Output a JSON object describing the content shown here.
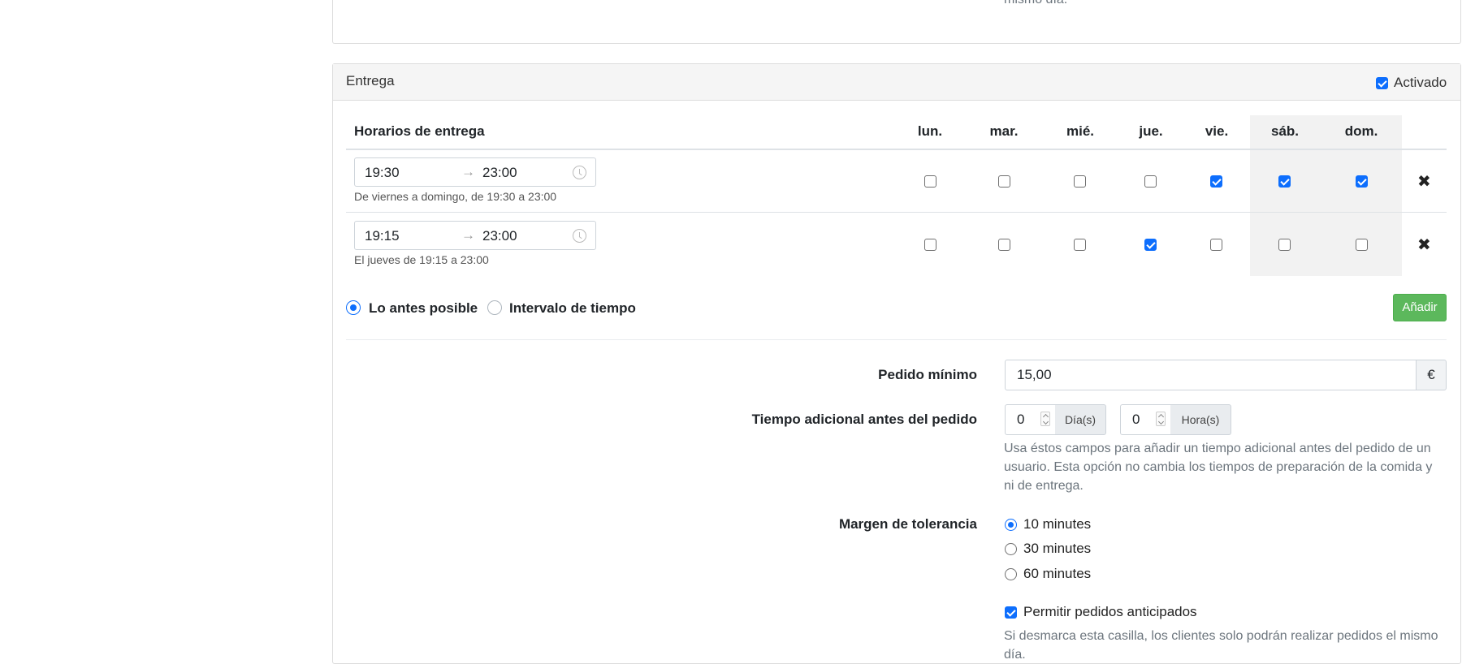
{
  "previous_section": {
    "help_tail": "mismo día."
  },
  "delivery": {
    "title": "Entrega",
    "enabled_label": "Activado",
    "enabled": true,
    "schedule": {
      "title": "Horarios de entrega",
      "days": [
        "lun.",
        "mar.",
        "mié.",
        "jue.",
        "vie.",
        "sáb.",
        "dom."
      ],
      "rows": [
        {
          "from": "19:30",
          "to": "23:00",
          "arrow": "→",
          "description": "De viernes a domingo, de 19:30 a 23:00",
          "days_checked": [
            false,
            false,
            false,
            false,
            true,
            true,
            true
          ],
          "remove_glyph": "✖"
        },
        {
          "from": "19:15",
          "to": "23:00",
          "arrow": "→",
          "description": "El jueves de 19:15 a 23:00",
          "days_checked": [
            false,
            false,
            false,
            true,
            false,
            false,
            false
          ],
          "remove_glyph": "✖"
        }
      ]
    },
    "mode_options": [
      {
        "label": "Lo antes posible",
        "selected": true
      },
      {
        "label": "Intervalo de tiempo",
        "selected": false
      }
    ],
    "add_button_label": "Añadir",
    "min_order": {
      "label": "Pedido mínimo",
      "value": "15,00",
      "currency": "€"
    },
    "extra_time": {
      "label": "Tiempo adicional antes del pedido",
      "days_value": "0",
      "days_unit": "Día(s)",
      "hours_value": "0",
      "hours_unit": "Hora(s)",
      "help": "Usa éstos campos para añadir un tiempo adicional antes del pedido de un usuario. Esta opción no cambia los tiempos de preparación de la comida y ni de entrega."
    },
    "tolerance": {
      "label": "Margen de tolerancia",
      "options": [
        {
          "label": "10 minutes",
          "selected": true
        },
        {
          "label": "30 minutes",
          "selected": false
        },
        {
          "label": "60 minutes",
          "selected": false
        }
      ]
    },
    "advance_orders": {
      "label": "Permitir pedidos anticipados",
      "checked": true,
      "help": "Si desmarca esta casilla, los clientes solo podrán realizar pedidos el mismo día."
    }
  },
  "colors": {
    "primary": "#0d6efd",
    "success": "#5cb85c",
    "header_bg": "#f5f5f5",
    "weekend_bg": "#f2f2f2"
  }
}
